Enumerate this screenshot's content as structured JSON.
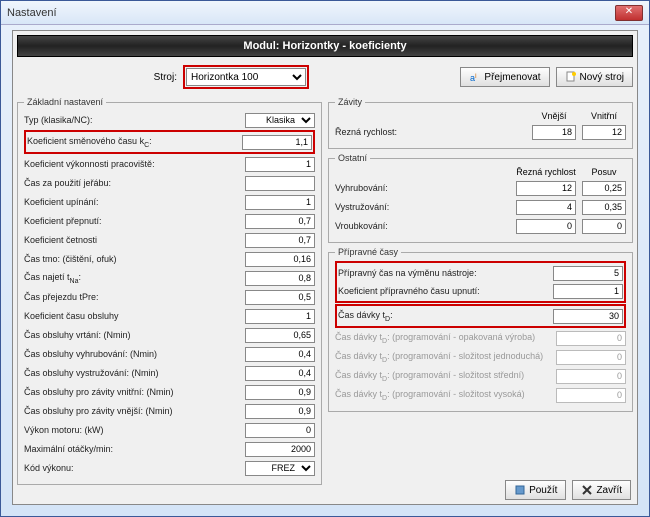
{
  "window": {
    "title": "Nastavení"
  },
  "header": "Modul: Horizontky - koeficienty",
  "top": {
    "strojLabel": "Stroj:",
    "strojValue": "Horizontka 100",
    "btnRename": "Přejmenovat",
    "btnNew": "Nový stroj"
  },
  "zakladni": {
    "legend": "Základní nastavení",
    "typLabel": "Typ (klasika/NC):",
    "typValue": "Klasika",
    "rows": [
      {
        "label": "Koeficient směnového času k",
        "sub": "C",
        "suffix": ":",
        "value": "1,1",
        "red": true
      },
      {
        "label": "Koeficient výkonnosti pracoviště:",
        "value": "1"
      },
      {
        "label": "Čas za použití jeřábu:",
        "value": ""
      },
      {
        "label": "Koeficient upínání:",
        "value": "1"
      },
      {
        "label": "Koeficient přepnutí:",
        "value": "0,7"
      },
      {
        "label": "Koeficient četnosti",
        "value": "0,7"
      },
      {
        "label": "Čas tmo: (čištění, ofuk)",
        "value": "0,16"
      },
      {
        "label": "Čas najetí t",
        "sub": "Na",
        "suffix": ":",
        "value": "0,8"
      },
      {
        "label": "Čas přejezdu tPre:",
        "value": "0,5"
      },
      {
        "label": "Koeficient času obsluhy",
        "value": "1"
      },
      {
        "label": "Čas obsluhy vrtání: (Nmin)",
        "value": "0,65"
      },
      {
        "label": "Čas obsluhy vyhrubování: (Nmin)",
        "value": "0,4"
      },
      {
        "label": "Čas obsluhy vystružování: (Nmin)",
        "value": "0,4"
      },
      {
        "label": "Čas obsluhy pro závity vnitřní: (Nmin)",
        "value": "0,9"
      },
      {
        "label": "Čas obsluhy pro závity vnější: (Nmin)",
        "value": "0,9"
      },
      {
        "label": "Výkon motoru: (kW)",
        "value": "0"
      },
      {
        "label": "Maximální otáčky/min:",
        "value": "2000"
      }
    ],
    "kodLabel": "Kód výkonu:",
    "kodValue": "FREZ"
  },
  "zavity": {
    "legend": "Závity",
    "colVnejsi": "Vnější",
    "colVnitrni": "Vnitřní",
    "rezna": "Řezná rychlost:",
    "reznaV1": "18",
    "reznaV2": "12"
  },
  "ostatni": {
    "legend": "Ostatní",
    "colRezna": "Řezná rychlost",
    "colPosuv": "Posuv",
    "rows": [
      {
        "label": "Vyhrubování:",
        "v1": "12",
        "v2": "0,25"
      },
      {
        "label": "Vystružování:",
        "v1": "4",
        "v2": "0,35"
      },
      {
        "label": "Vroubkování:",
        "v1": "0",
        "v2": "0"
      }
    ]
  },
  "pripravne": {
    "legend": "Přípravné časy",
    "rows1": [
      {
        "label": "Přípravný čas na výměnu nástroje:",
        "value": "5"
      },
      {
        "label": "Koeficient přípravného času upnutí:",
        "value": "1"
      }
    ],
    "davkaLabel": "Čas dávky t",
    "davkaSub": "D",
    "davkaSuffix": ":",
    "davkaValue": "30",
    "dimRows": [
      {
        "label": "Čas dávky t",
        "sub": "D",
        "suffix": ": (programování - opakovaná výroba)",
        "value": "0"
      },
      {
        "label": "Čas dávky t",
        "sub": "D",
        "suffix": ": (programování - složitost jednoduchá)",
        "value": "0"
      },
      {
        "label": "Čas dávky t",
        "sub": "D",
        "suffix": ": (programování - složitost střední)",
        "value": "0"
      },
      {
        "label": "Čas dávky t",
        "sub": "D",
        "suffix": ": (programování - složitost vysoká)",
        "value": "0"
      }
    ]
  },
  "footer": {
    "apply": "Použít",
    "close": "Zavřít"
  }
}
